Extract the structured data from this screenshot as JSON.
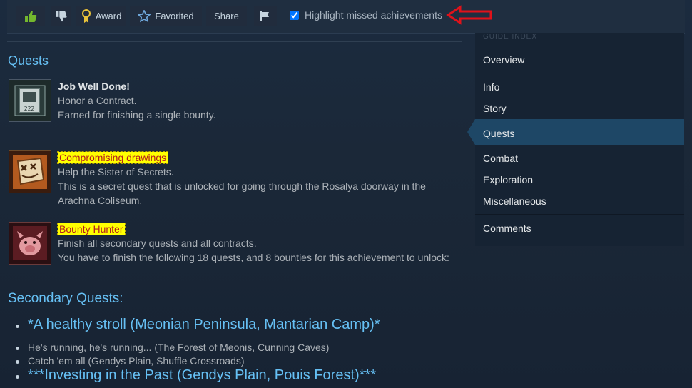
{
  "toolbar": {
    "award_label": "Award",
    "favorited_label": "Favorited",
    "share_label": "Share",
    "highlight_label": "Highlight missed achievements",
    "highlight_checked": true
  },
  "sections": {
    "quests_title": "Quests",
    "secondary_title": "Secondary Quests:"
  },
  "achievements": [
    {
      "name": "Job Well Done!",
      "line1": "Honor a Contract.",
      "line2": "Earned for finishing a single bounty.",
      "missed": false
    },
    {
      "name": "Compromising drawings",
      "line1": "Help the Sister of Secrets.",
      "line2": "This is a secret quest that is unlocked for going through the Rosalya doorway in the Arachna Coliseum.",
      "missed": true
    },
    {
      "name": "Bounty Hunter",
      "line1": "Finish all secondary quests and all contracts.",
      "line2": "You have to finish the following 18 quests, and 8 bounties for this achievement to unlock:",
      "missed": true
    }
  ],
  "secondary": {
    "item1": "*A healthy stroll (Meonian Peninsula, Mantarian Camp)*",
    "sub1": "He's running, he's running... (The Forest of Meonis, Cunning Caves)",
    "sub2": "Catch 'em all (Gendys Plain, Shuffle Crossroads)",
    "item2": "***Investing in the Past (Gendys Plain, Pouis Forest)***"
  },
  "sidebar": {
    "faded_title": "GUIDE INDEX",
    "items": [
      "Overview",
      "Info",
      "Story",
      "Quests",
      "Combat",
      "Exploration",
      "Miscellaneous",
      "Comments"
    ],
    "active": "Quests"
  },
  "icons": {
    "job_icon_number": "222"
  },
  "colors": {
    "accent": "#66c0f4",
    "highlight_bg": "#ffff00",
    "highlight_text": "#b31d1d",
    "arrow": "#e0121a",
    "thumb_up": "#74b72e"
  }
}
